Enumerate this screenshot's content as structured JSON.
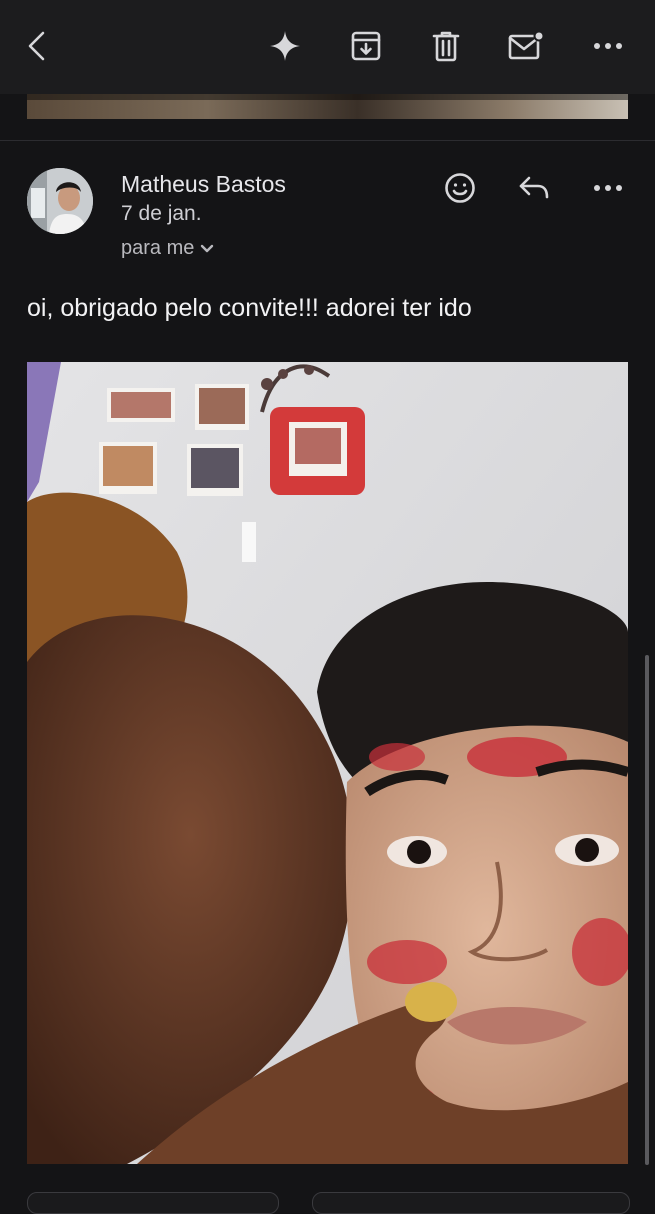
{
  "toolbar": {
    "icons": [
      "back-icon",
      "sparkle-icon",
      "archive-icon",
      "delete-icon",
      "mark-unread-icon",
      "more-icon"
    ]
  },
  "message": {
    "sender": "Matheus Bastos",
    "date": "7 de jan.",
    "recipient": "para me",
    "body": "oi, obrigado pelo convite!!! adorei ter ido",
    "actions": [
      "emoji-reaction-icon",
      "reply-icon",
      "more-icon"
    ]
  },
  "colors": {
    "background": "#141416",
    "toolbar": "#1c1c1e",
    "text": "#e6e6ea",
    "secondary_text": "#b9b9be"
  }
}
